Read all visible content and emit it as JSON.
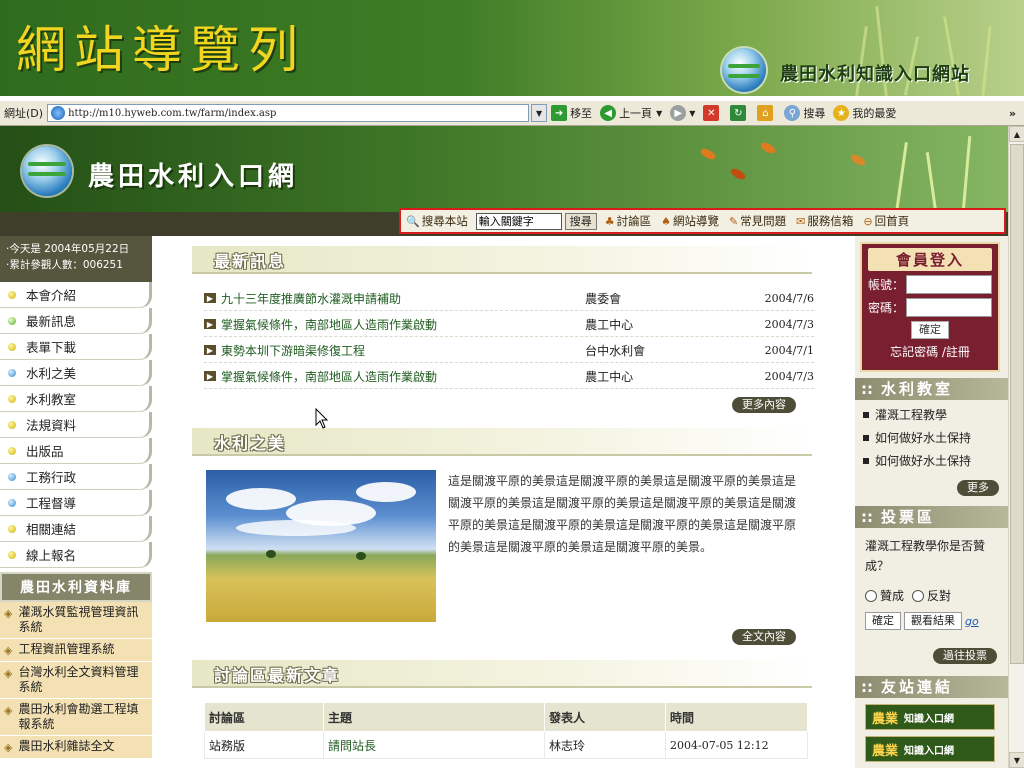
{
  "slide": {
    "title": "網站導覽列",
    "brand": "農田水利知識入口網站"
  },
  "browser": {
    "address_label": "網址(D)",
    "url": "http://m10.hyweb.com.tw/farm/index.asp",
    "go": "移至",
    "back": "上一頁",
    "search": "搜尋",
    "favorites": "我的最愛",
    "more": "»"
  },
  "site": {
    "title": "農田水利入口網"
  },
  "nav": {
    "search_site": "搜尋本站",
    "search_placeholder": "輸入關鍵字",
    "search_button": "搜尋",
    "items": [
      "討論區",
      "網站導覽",
      "常見問題",
      "服務信箱",
      "回首頁"
    ]
  },
  "left": {
    "today": "‧今天是 2004年05月22日",
    "visitors": "‧累計參觀人數：006251",
    "menu": [
      "本會介紹",
      "最新訊息",
      "表單下載",
      "水利之美",
      "水利教室",
      "法規資料",
      "出版品",
      "工務行政",
      "工程督導",
      "相關連結",
      "線上報名"
    ],
    "db_title": "農田水利資料庫",
    "db_items": [
      "灌溉水質監視管理資訊系統",
      "工程資訊管理系統",
      "台灣水利全文資料管理系統",
      "農田水利會勘選工程填報系統",
      "農田水利雜誌全文"
    ]
  },
  "news": {
    "title": "最新訊息",
    "items": [
      {
        "title": "九十三年度推廣節水灌溉申請補助",
        "source": "農委會",
        "date": "2004/7/6"
      },
      {
        "title": "掌握氣候條件，南部地區人造雨作業啟動",
        "source": "農工中心",
        "date": "2004/7/3"
      },
      {
        "title": "東勢本圳下游暗渠修復工程",
        "source": "台中水利會",
        "date": "2004/7/1"
      },
      {
        "title": "掌握氣候條件，南部地區人造雨作業啟動",
        "source": "農工中心",
        "date": "2004/7/3"
      }
    ],
    "more": "更多內容"
  },
  "beauty": {
    "title": "水利之美",
    "text": "這是關渡平原的美景這是關渡平原的美景這是關渡平原的美景這是關渡平原的美景這是關渡平原的美景這是關渡平原的美景這是關渡平原的美景這是關渡平原的美景這是關渡平原的美景這是關渡平原的美景這是關渡平原的美景這是關渡平原的美景。",
    "more": "全文內容"
  },
  "forum": {
    "title": "討論區最新文章",
    "headers": [
      "討論區",
      "主題",
      "發表人",
      "時間"
    ],
    "rows": [
      [
        "站務版",
        "請問站長",
        "林志玲",
        "2004-07-05 12:12"
      ]
    ]
  },
  "login": {
    "title": "會員登入",
    "account_label": "帳號：",
    "password_label": "密碼：",
    "confirm": "確定",
    "forget": "忘記密碼 /註冊"
  },
  "classroom": {
    "title": "水利教室",
    "items": [
      "灌溉工程教學",
      "如何做好水土保持",
      "如何做好水土保持"
    ],
    "more": "更多"
  },
  "vote": {
    "title": "投票區",
    "question": "灌溉工程教學你是否贊成？",
    "agree": "贊成",
    "oppose": "反對",
    "confirm": "確定",
    "results": "觀看結果",
    "go": "go",
    "past": "過往投票"
  },
  "friends": {
    "title": "友站連結",
    "banner_main": "農業",
    "banner_small": "知識入口網"
  }
}
